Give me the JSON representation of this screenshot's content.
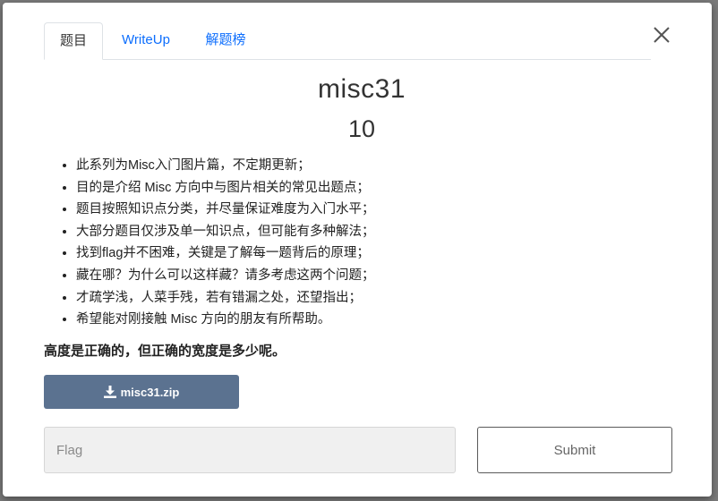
{
  "tabs": [
    {
      "label": "题目"
    },
    {
      "label": "WriteUp"
    },
    {
      "label": "解题榜"
    }
  ],
  "challenge": {
    "name": "misc31",
    "points": "10",
    "description": [
      "此系列为Misc入门图片篇，不定期更新；",
      "目的是介绍 Misc 方向中与图片相关的常见出题点；",
      "题目按照知识点分类，并尽量保证难度为入门水平；",
      "大部分题目仅涉及单一知识点，但可能有多种解法；",
      "找到flag并不困难，关键是了解每一题背后的原理；",
      "藏在哪？为什么可以这样藏？请多考虑这两个问题；",
      "才疏学浅，人菜手残，若有错漏之处，还望指出；",
      "希望能对刚接触 Misc 方向的朋友有所帮助。"
    ],
    "question": "高度是正确的，但正确的宽度是多少呢。",
    "file": "misc31.zip"
  },
  "form": {
    "flag_placeholder": "Flag",
    "flag_value": "",
    "submit_label": "Submit"
  },
  "icons": {
    "close": "close-icon",
    "download": "download-icon"
  },
  "colors": {
    "link": "#0d6efd",
    "download_button": "#5b7290",
    "input_bg": "#f0f0f0"
  }
}
